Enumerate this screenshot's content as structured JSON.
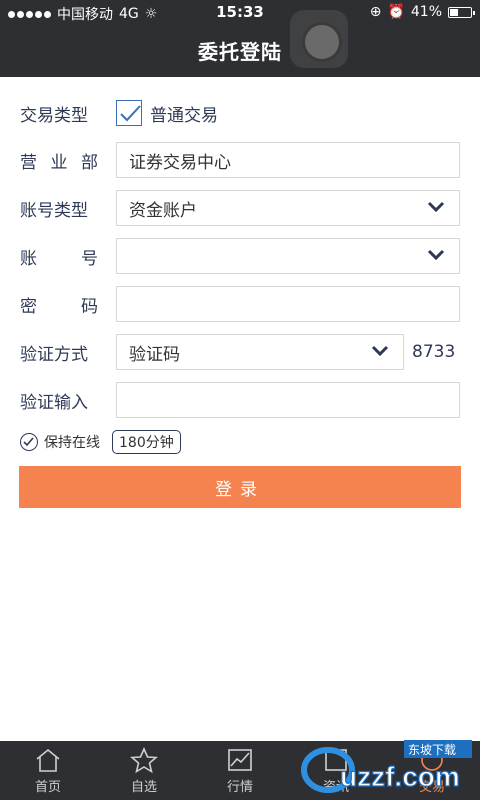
{
  "status_bar": {
    "carrier": "中国移动",
    "network": "4G",
    "time": "15:33",
    "battery": "41%",
    "battery_level": 0.41
  },
  "nav": {
    "title": "委托登陆"
  },
  "form": {
    "trade_type": {
      "label": "交易类型",
      "option": "普通交易",
      "checked": true
    },
    "branch": {
      "label": "营业部",
      "label_chars": [
        "营",
        "业",
        "部"
      ],
      "value": "证券交易中心"
    },
    "account_type": {
      "label": "账号类型",
      "value": "资金账户"
    },
    "account": {
      "label": "账号",
      "label_chars": [
        "账",
        "号"
      ],
      "value": ""
    },
    "password": {
      "label": "密码",
      "label_chars": [
        "密",
        "码"
      ],
      "value": ""
    },
    "verify_method": {
      "label": "验证方式",
      "value": "验证码",
      "code": "8733"
    },
    "verify_input": {
      "label": "验证输入",
      "value": ""
    }
  },
  "keep_online": {
    "label": "保持在线",
    "duration": "180分钟"
  },
  "login_button": {
    "label": "登录"
  },
  "tabbar": {
    "items": [
      {
        "label": "首页",
        "icon": "home-icon"
      },
      {
        "label": "自选",
        "icon": "star-icon"
      },
      {
        "label": "行情",
        "icon": "chart-icon"
      },
      {
        "label": "资讯",
        "icon": "news-icon"
      },
      {
        "label": "交易",
        "icon": "trade-icon",
        "active": true
      }
    ]
  },
  "watermark": {
    "text": "uzzf.com",
    "subtext": "东坡下载"
  },
  "colors": {
    "header": "#2e2f33",
    "accent": "#f5834f",
    "label": "#2e3a55",
    "checkbox": "#3b6fb6"
  }
}
